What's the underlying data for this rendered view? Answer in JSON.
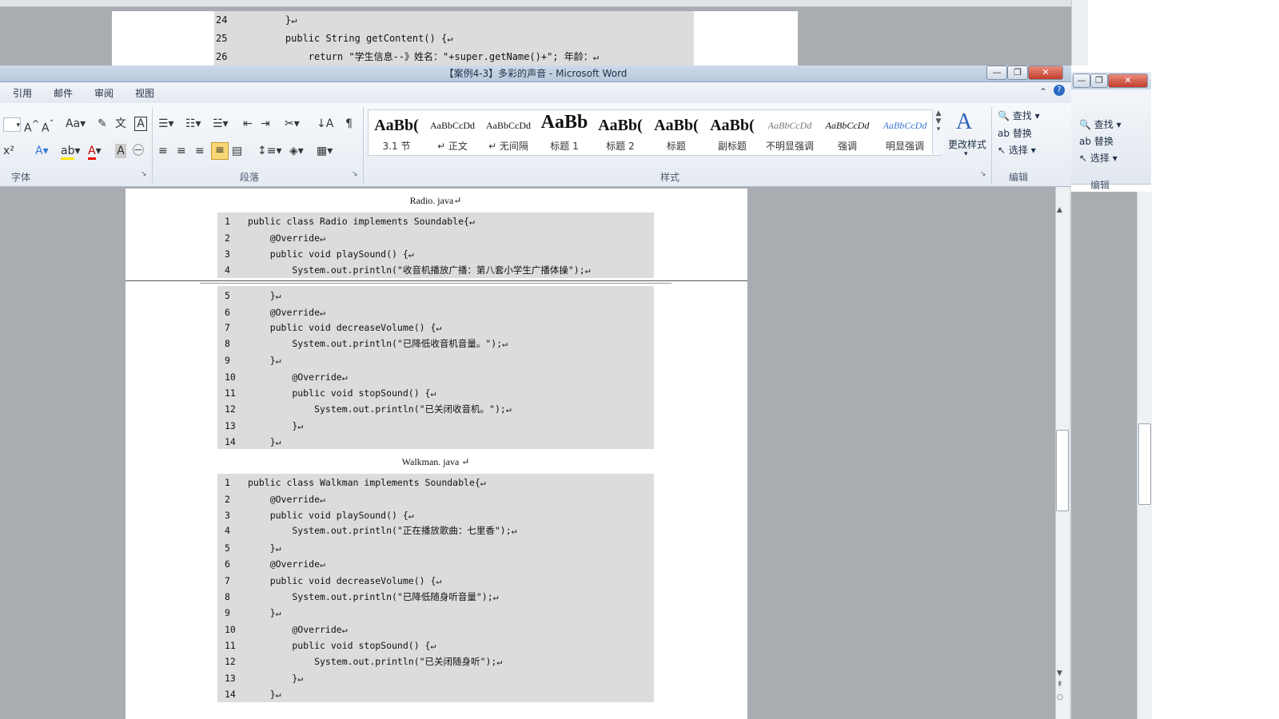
{
  "background_window": {
    "code_lines": [
      {
        "num": "24",
        "text": "    }↵"
      },
      {
        "num": "25",
        "text": "    public String getContent() {↵"
      },
      {
        "num": "26",
        "text": "        return \"学生信息--》姓名：\"+super.getName()+\"; 年龄：↵"
      }
    ]
  },
  "window": {
    "title": "【案例4-3】多彩的声音 - Microsoft Word",
    "minimize": "—",
    "restore": "❐",
    "close": "✕"
  },
  "tabs": [
    "引用",
    "邮件",
    "审阅",
    "视图"
  ],
  "ribbon": {
    "groups": {
      "font": "字体",
      "paragraph": "段落",
      "styles": "样式",
      "editing": "编辑"
    },
    "styles": [
      {
        "sample": "AaBb(",
        "name": "3.1 节"
      },
      {
        "sample": "AaBbCcDd",
        "name": "↵ 正文"
      },
      {
        "sample": "AaBbCcDd",
        "name": "↵ 无间隔"
      },
      {
        "sample": "AaBb",
        "name": "标题 1"
      },
      {
        "sample": "AaBb(",
        "name": "标题 2"
      },
      {
        "sample": "AaBb(",
        "name": "标题"
      },
      {
        "sample": "AaBb(",
        "name": "副标题"
      },
      {
        "sample": "AaBbCcDd",
        "name": "不明显强调"
      },
      {
        "sample": "AaBbCcDd",
        "name": "强调"
      },
      {
        "sample": "AaBbCcDd",
        "name": "明显强调"
      }
    ],
    "change_styles": "更改样式",
    "edit": {
      "find": "查找",
      "replace": "替换",
      "select": "选择"
    }
  },
  "third_window": {
    "edit": {
      "find": "查找",
      "replace": "替换",
      "select": "选择",
      "group": "编辑"
    }
  },
  "document": {
    "radio": {
      "title": "Radio. java↵",
      "lines": [
        {
          "num": "1",
          "text": "public class Radio implements Soundable{↵"
        },
        {
          "num": "2",
          "text": "    @Override↵"
        },
        {
          "num": "3",
          "text": "    public void playSound() {↵"
        },
        {
          "num": "4",
          "text": "        System.out.println(\"收音机播放广播：第八套小学生广播体操\");↵"
        },
        {
          "num": "5",
          "text": "    }↵"
        },
        {
          "num": "6",
          "text": "    @Override↵"
        },
        {
          "num": "7",
          "text": "    public void decreaseVolume() {↵"
        },
        {
          "num": "8",
          "text": "        System.out.println(\"已降低收音机音量。\");↵"
        },
        {
          "num": "9",
          "text": "    }↵"
        },
        {
          "num": "10",
          "text": "        @Override↵"
        },
        {
          "num": "11",
          "text": "        public void stopSound() {↵"
        },
        {
          "num": "12",
          "text": "            System.out.println(\"已关闭收音机。\");↵"
        },
        {
          "num": "13",
          "text": "        }↵"
        },
        {
          "num": "14",
          "text": "    }↵"
        }
      ]
    },
    "walkman": {
      "title": "Walkman. java ↵",
      "lines": [
        {
          "num": "1",
          "text": "public class Walkman implements Soundable{↵"
        },
        {
          "num": "2",
          "text": "    @Override↵"
        },
        {
          "num": "3",
          "text": "    public void playSound() {↵"
        },
        {
          "num": "4",
          "text": "        System.out.println(\"正在播放歌曲：七里香\");↵"
        },
        {
          "num": "5",
          "text": "    }↵"
        },
        {
          "num": "6",
          "text": "    @Override↵"
        },
        {
          "num": "7",
          "text": "    public void decreaseVolume() {↵"
        },
        {
          "num": "8",
          "text": "        System.out.println(\"已降低随身听音量\");↵"
        },
        {
          "num": "9",
          "text": "    }↵"
        },
        {
          "num": "10",
          "text": "        @Override↵"
        },
        {
          "num": "11",
          "text": "        public void stopSound() {↵"
        },
        {
          "num": "12",
          "text": "            System.out.println(\"已关闭随身听\");↵"
        },
        {
          "num": "13",
          "text": "        }↵"
        },
        {
          "num": "14",
          "text": "    }↵"
        }
      ]
    }
  }
}
